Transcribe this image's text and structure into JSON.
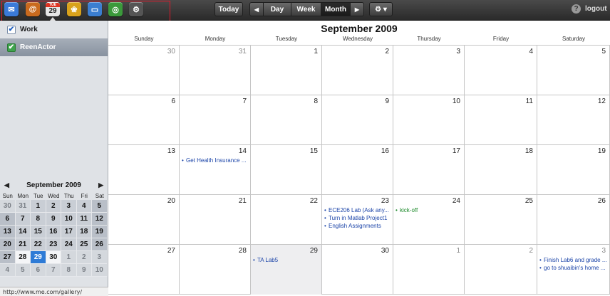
{
  "toolbar": {
    "apps": [
      {
        "name": "mail",
        "color": "#3a7ad8",
        "glyph": "✉"
      },
      {
        "name": "contacts",
        "color": "#c96a1e",
        "glyph": "@"
      },
      {
        "name": "calendar",
        "color": "#e5e5e5",
        "glyph": "",
        "day_label": "TUE",
        "day_num": "29"
      },
      {
        "name": "gallery",
        "color": "#d9a21b",
        "glyph": "❀"
      },
      {
        "name": "idisk",
        "color": "#3b7ed0",
        "glyph": "▭"
      },
      {
        "name": "find-my-iphone",
        "color": "#3b9a3b",
        "glyph": "◎"
      },
      {
        "name": "account",
        "color": "#555555",
        "glyph": "⚙"
      }
    ],
    "today": "Today",
    "prev": "◀",
    "day": "Day",
    "week": "Week",
    "month": "Month",
    "next": "▶",
    "gear": "⚙ ▾",
    "help": "?",
    "logout": "logout"
  },
  "sidebar": {
    "calendars": [
      {
        "name": "Work",
        "checked": true
      },
      {
        "name": "ReenActor",
        "checked": true
      }
    ],
    "mini_calendar": {
      "title": "September 2009",
      "prev": "◀",
      "next": "▶",
      "dow": [
        "Sun",
        "Mon",
        "Tue",
        "Wed",
        "Thu",
        "Fri",
        "Sat"
      ],
      "days": [
        [
          "30",
          "31",
          "1",
          "2",
          "3",
          "4",
          "5"
        ],
        [
          "6",
          "7",
          "8",
          "9",
          "10",
          "11",
          "12"
        ],
        [
          "13",
          "14",
          "15",
          "16",
          "17",
          "18",
          "19"
        ],
        [
          "20",
          "21",
          "22",
          "23",
          "24",
          "25",
          "26"
        ],
        [
          "27",
          "28",
          "29",
          "30",
          "1",
          "2",
          "3"
        ],
        [
          "4",
          "5",
          "6",
          "7",
          "8",
          "9",
          "10"
        ]
      ],
      "today": "29"
    }
  },
  "status_url": "http://www.me.com/gallery/",
  "main": {
    "title": "September 2009",
    "dow": [
      "Sunday",
      "Monday",
      "Tuesday",
      "Wednesday",
      "Thursday",
      "Friday",
      "Saturday"
    ],
    "weeks": [
      [
        {
          "d": "30",
          "o": true
        },
        {
          "d": "31",
          "o": true
        },
        {
          "d": "1"
        },
        {
          "d": "2"
        },
        {
          "d": "3"
        },
        {
          "d": "4"
        },
        {
          "d": "5"
        }
      ],
      [
        {
          "d": "6"
        },
        {
          "d": "7"
        },
        {
          "d": "8"
        },
        {
          "d": "9"
        },
        {
          "d": "10"
        },
        {
          "d": "11"
        },
        {
          "d": "12"
        }
      ],
      [
        {
          "d": "13"
        },
        {
          "d": "14",
          "ev": [
            {
              "t": "Get Health Insurance ..."
            }
          ]
        },
        {
          "d": "15"
        },
        {
          "d": "16"
        },
        {
          "d": "17"
        },
        {
          "d": "18"
        },
        {
          "d": "19"
        }
      ],
      [
        {
          "d": "20"
        },
        {
          "d": "21"
        },
        {
          "d": "22"
        },
        {
          "d": "23",
          "ev": [
            {
              "t": "ECE206 Lab (Ask any..."
            },
            {
              "t": "Turn in Matlab Project1"
            },
            {
              "t": "English Assignments"
            }
          ]
        },
        {
          "d": "24",
          "ev": [
            {
              "t": "kick-off",
              "green": true
            }
          ]
        },
        {
          "d": "25"
        },
        {
          "d": "26"
        }
      ],
      [
        {
          "d": "27"
        },
        {
          "d": "28"
        },
        {
          "d": "29",
          "today": true,
          "ev": [
            {
              "t": "TA Lab5"
            }
          ]
        },
        {
          "d": "30"
        },
        {
          "d": "1",
          "o": true
        },
        {
          "d": "2",
          "o": true
        },
        {
          "d": "3",
          "o": true,
          "ev": [
            {
              "t": "Finish Lab6 and grade ..."
            },
            {
              "t": "go to shuaibin's home ..."
            }
          ]
        }
      ]
    ]
  }
}
